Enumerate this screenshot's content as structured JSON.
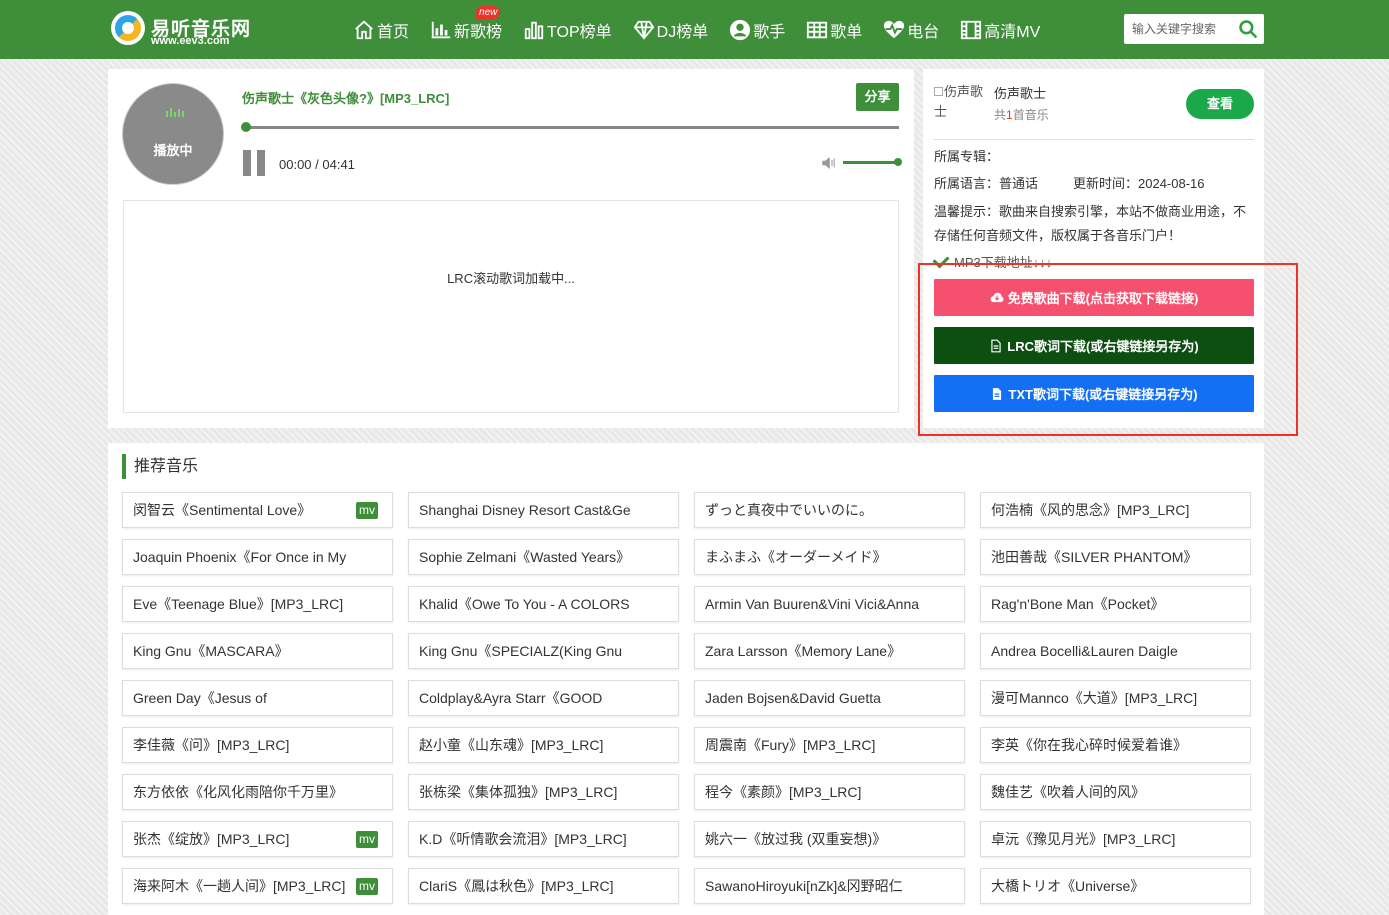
{
  "header": {
    "logo_name": "易听音乐网",
    "logo_url": "www.eev3.com",
    "nav": [
      {
        "label": "首页",
        "icon": "home-icon"
      },
      {
        "label": "新歌榜",
        "icon": "bar-chart-icon",
        "badge": "new"
      },
      {
        "label": "TOP榜单",
        "icon": "stats-icon"
      },
      {
        "label": "DJ榜单",
        "icon": "diamond-icon"
      },
      {
        "label": "歌手",
        "icon": "user-icon"
      },
      {
        "label": "歌单",
        "icon": "grid-icon"
      },
      {
        "label": "电台",
        "icon": "heartbeat-icon"
      },
      {
        "label": "高清MV",
        "icon": "film-icon"
      }
    ],
    "search_placeholder": "输入关键字搜索"
  },
  "player": {
    "disc_status": "播放中",
    "song_title": "伤声歌士《灰色头像?》[MP3_LRC]",
    "share_label": "分享",
    "time": "00:00 / 04:41",
    "progress": 0,
    "volume": 1.0,
    "lrc_text": "LRC滚动歌词加载中..."
  },
  "info": {
    "artist_img_alt": "伤声歌士",
    "artist_name": "伤声歌士",
    "artist_count_prefix": "共",
    "artist_count": "1",
    "artist_count_suffix": "首音乐",
    "view_label": "查看",
    "album": "所属专辑：",
    "language": "所属语言：普通话",
    "updated": "更新时间：2024-08-16",
    "tip": "温馨提示：歌曲来自搜索引擎，本站不做商业用途，不存储任何音频文件，版权属于各音乐门户！",
    "download_label": "MP3下载地址↓↓↓",
    "buttons": [
      {
        "label": "免费歌曲下载(点击获取下载链接)",
        "color": "#f5516e",
        "icon": "cloud-download-icon"
      },
      {
        "label": "LRC歌词下载(或右键链接另存为)",
        "color": "#0d4f11",
        "icon": "file-icon"
      },
      {
        "label": "TXT歌词下载(或右键链接另存为)",
        "color": "#1370f5",
        "icon": "file-text-icon"
      }
    ]
  },
  "recommend": {
    "title": "推荐音乐",
    "items": [
      {
        "label": "闵智云《Sentimental Love》",
        "mv": "mv"
      },
      {
        "label": "Shanghai Disney Resort Cast&Ge"
      },
      {
        "label": "ずっと真夜中でいいのに。"
      },
      {
        "label": "何浩楠《风的思念》[MP3_LRC]"
      },
      {
        "label": "Joaquin Phoenix《For Once in My"
      },
      {
        "label": "Sophie Zelmani《Wasted Years》"
      },
      {
        "label": "まふまふ《オーダーメイド》"
      },
      {
        "label": "池田善哉《SILVER PHANTOM》"
      },
      {
        "label": "Eve《Teenage Blue》[MP3_LRC]"
      },
      {
        "label": "Khalid《Owe To You - A COLORS"
      },
      {
        "label": "Armin Van Buuren&Vini Vici&Anna"
      },
      {
        "label": "Rag'n'Bone Man《Pocket》"
      },
      {
        "label": "King Gnu《MASCARA》"
      },
      {
        "label": "King Gnu《SPECIALZ(King Gnu"
      },
      {
        "label": "Zara Larsson《Memory Lane》"
      },
      {
        "label": "Andrea Bocelli&Lauren Daigle"
      },
      {
        "label": "Green Day《Jesus of"
      },
      {
        "label": "Coldplay&Ayra Starr《GOOD"
      },
      {
        "label": "Jaden Bojsen&David Guetta"
      },
      {
        "label": "漫可Mannco《大道》[MP3_LRC]"
      },
      {
        "label": "李佳薇《问》[MP3_LRC]"
      },
      {
        "label": "赵小童《山东魂》[MP3_LRC]"
      },
      {
        "label": "周震南《Fury》[MP3_LRC]"
      },
      {
        "label": "李英《你在我心碎时候爱着谁》"
      },
      {
        "label": "东方依依《化风化雨陪你千万里》"
      },
      {
        "label": "张栋梁《集体孤独》[MP3_LRC]"
      },
      {
        "label": "程今《素颜》[MP3_LRC]"
      },
      {
        "label": "魏佳艺《吹着人间的风》"
      },
      {
        "label": "张杰《绽放》[MP3_LRC]",
        "mv": "mv"
      },
      {
        "label": "K.D《听情歌会流泪》[MP3_LRC]"
      },
      {
        "label": "姚六一《放过我 (双重妄想)》"
      },
      {
        "label": "卓沅《豫见月光》[MP3_LRC]"
      },
      {
        "label": "海来阿木《一趟人间》[MP3_LRC]",
        "mv": "mv"
      },
      {
        "label": "ClariS《鳳は秋色》[MP3_LRC]"
      },
      {
        "label": "SawanoHiroyuki[nZk]&冈野昭仁"
      },
      {
        "label": "大橋トリオ《Universe》"
      }
    ]
  },
  "colors": {
    "brand_green": "#3e8e3a",
    "view_green": "#1aa84a",
    "highlight_red": "#e8342b"
  }
}
